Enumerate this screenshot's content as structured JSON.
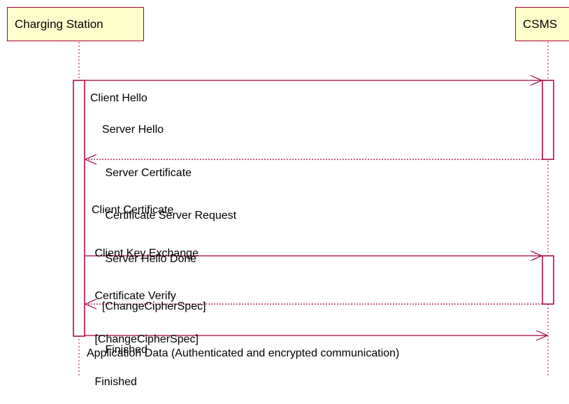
{
  "participants": {
    "charging_station": "Charging Station",
    "csms": "CSMS"
  },
  "messages": [
    {
      "id": "client-hello",
      "direction": "to-csms",
      "style": "solid",
      "lines": [
        "Client Hello"
      ]
    },
    {
      "id": "server-hello",
      "direction": "to-charging-station",
      "style": "dotted",
      "lines": [
        "Server Hello",
        " Server Certificate",
        " Certificate Server Request",
        " Server Hello Done"
      ]
    },
    {
      "id": "client-certificate",
      "direction": "to-csms",
      "style": "solid",
      "lines": [
        "Client Certificate",
        " Client Key Exchange",
        " Certificate Verify",
        " [ChangeCipherSpec]",
        " Finished"
      ]
    },
    {
      "id": "change-cipher-spec",
      "direction": "to-charging-station",
      "style": "dotted",
      "lines": [
        "[ChangeCipherSpec]",
        " Finished"
      ]
    },
    {
      "id": "application-data",
      "direction": "to-csms",
      "style": "solid",
      "lines": [
        "Application Data (Authenticated and encrypted communication)"
      ]
    }
  ],
  "colors": {
    "border": "#a80036",
    "participant_fill": "#ffffcc",
    "background": "#ffffff"
  }
}
